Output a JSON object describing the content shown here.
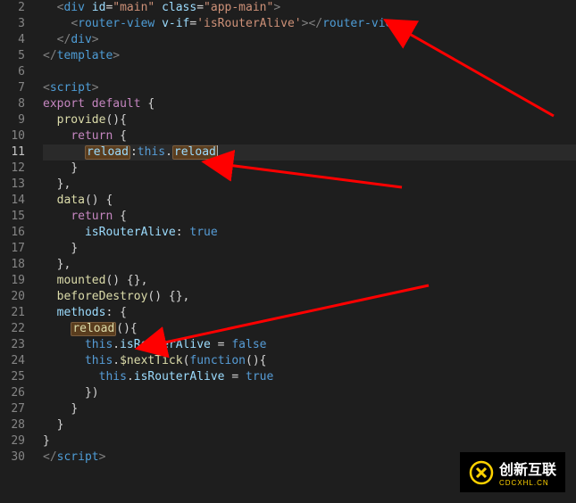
{
  "lines": {
    "start": 2,
    "end": 30,
    "current": 11
  },
  "code": {
    "l2": {
      "tag_open": "<",
      "div": "div",
      "id_attr": "id",
      "id_val": "\"main\"",
      "class_attr": "class",
      "class_val": "\"app-main\"",
      "close": ">"
    },
    "l3": {
      "tag_open": "<",
      "rv": "router-view",
      "vif": "v-if",
      "vif_val": "'isRouterAlive'",
      "mid": ">",
      "close_open": "</",
      "close": ">"
    },
    "l4": {
      "open": "</",
      "div": "div",
      "close": ">"
    },
    "l5": {
      "open": "</",
      "tmpl": "template",
      "close": ">"
    },
    "l7": {
      "open": "<",
      "script": "script",
      "close": ">"
    },
    "l8": {
      "export": "export",
      "default": "default",
      "brace": " {"
    },
    "l9": {
      "provide": "provide",
      "paren": "()",
      "brace": "{"
    },
    "l10": {
      "return": "return",
      "brace": " {"
    },
    "l11": {
      "reload1": "reload",
      "colon": ":",
      "this": "this",
      "dot": ".",
      "reload2": "reload"
    },
    "l12": {
      "brace": "}"
    },
    "l13": {
      "brace": "},"
    },
    "l14": {
      "data": "data",
      "paren": "()",
      "brace": " {"
    },
    "l15": {
      "return": "return",
      "brace": " {"
    },
    "l16": {
      "key": "isRouterAlive",
      "colon": ": ",
      "val": "true"
    },
    "l17": {
      "brace": "}"
    },
    "l18": {
      "brace": "},"
    },
    "l19": {
      "mounted": "mounted",
      "rest": "() {},"
    },
    "l20": {
      "bd": "beforeDestroy",
      "rest": "() {},"
    },
    "l21": {
      "methods": "methods",
      "colon": ": {"
    },
    "l22": {
      "reload": "reload",
      "rest": "(){"
    },
    "l23": {
      "this": "this",
      "dot": ".",
      "ira": "isRouterAlive",
      "eq": " = ",
      "false": "false"
    },
    "l24": {
      "this": "this",
      "dot1": ".",
      "nt": "$nextTick",
      "op": "(",
      "func": "function",
      "rest": "(){"
    },
    "l25": {
      "this": "this",
      "dot": ".",
      "ira": "isRouterAlive",
      "eq": " = ",
      "true": "true"
    },
    "l26": {
      "brace": "})"
    },
    "l27": {
      "brace": "}"
    },
    "l28": {
      "brace": "}"
    },
    "l29": {
      "brace": "}"
    },
    "l30": {
      "open": "</",
      "script": "script",
      "close": ">"
    }
  },
  "logo": {
    "main": "创新互联",
    "sub": "CDCXHL.CN"
  }
}
